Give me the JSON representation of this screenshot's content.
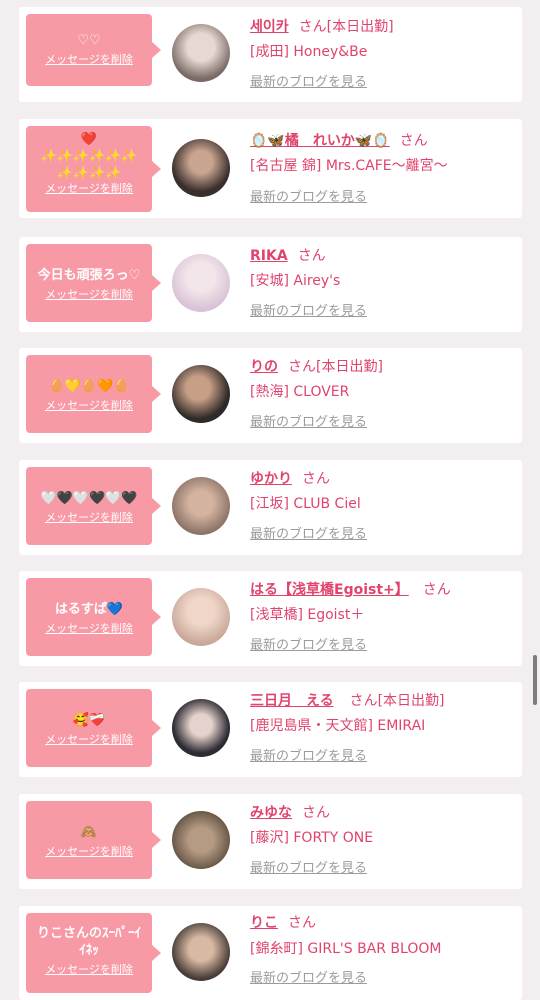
{
  "common": {
    "delete_label": "メッセージを削除",
    "blog_label": "最新のブログを見る",
    "honorific": "さん"
  },
  "items": [
    {
      "message": "♡♡",
      "name": "세이카",
      "status": "[本日出勤]",
      "shop": "[成田] Honey&Be",
      "avatar_icon": "portrait-photo",
      "avatar_color": "#7a6a66"
    },
    {
      "message": "❤️\n✨✨✨✨✨✨\n✨✨✨✨",
      "name": "🪞🦋橘　れいか🦋🪞",
      "status": "",
      "shop": "[名古屋 錦] Mrs.CAFE〜離宮〜",
      "avatar_icon": "portrait-photo",
      "avatar_color": "#3a2f2d"
    },
    {
      "message": "今日も頑張ろっ♡",
      "name": "RIKA",
      "status": "",
      "shop": "[安城] Airey's",
      "avatar_icon": "portrait-photo",
      "avatar_color": "#d9c3d6"
    },
    {
      "message": "🥚💛🥚🧡🥚",
      "name": "りの",
      "status": "[本日出勤]",
      "shop": "[熱海] CLOVER",
      "avatar_icon": "portrait-photo",
      "avatar_color": "#2f2a27"
    },
    {
      "message": "🤍🖤🤍🖤🤍🖤",
      "name": "ゆかり",
      "status": "",
      "shop": "[江坂] CLUB Ciel",
      "avatar_icon": "portrait-photo",
      "avatar_color": "#8c7466"
    },
    {
      "message": "はるすぱ💙",
      "name": "はる【浅草橋Egoist+】",
      "status": "",
      "shop": "[浅草橋] Egoist＋",
      "avatar_icon": "portrait-photo",
      "avatar_color": "#c9a99a"
    },
    {
      "message": "🥰❤️‍🩹",
      "name": "三日月　える",
      "status": "[本日出勤]",
      "shop": "[鹿児島県・天文館] EMIRAI",
      "avatar_icon": "portrait-photo",
      "avatar_color": "#2d2b33"
    },
    {
      "message": "🙈",
      "name": "みゆな",
      "status": "",
      "shop": "[藤沢] FORTY ONE",
      "avatar_icon": "portrait-photo",
      "avatar_color": "#6b5a48"
    },
    {
      "message": "りこさんのｽｰﾊﾟｰｲ\nｲﾈｯ",
      "name": "りこ",
      "status": "",
      "shop": "[錦糸町] GIRL'S BAR BLOOM",
      "avatar_icon": "portrait-photo",
      "avatar_color": "#4a3d38"
    }
  ]
}
